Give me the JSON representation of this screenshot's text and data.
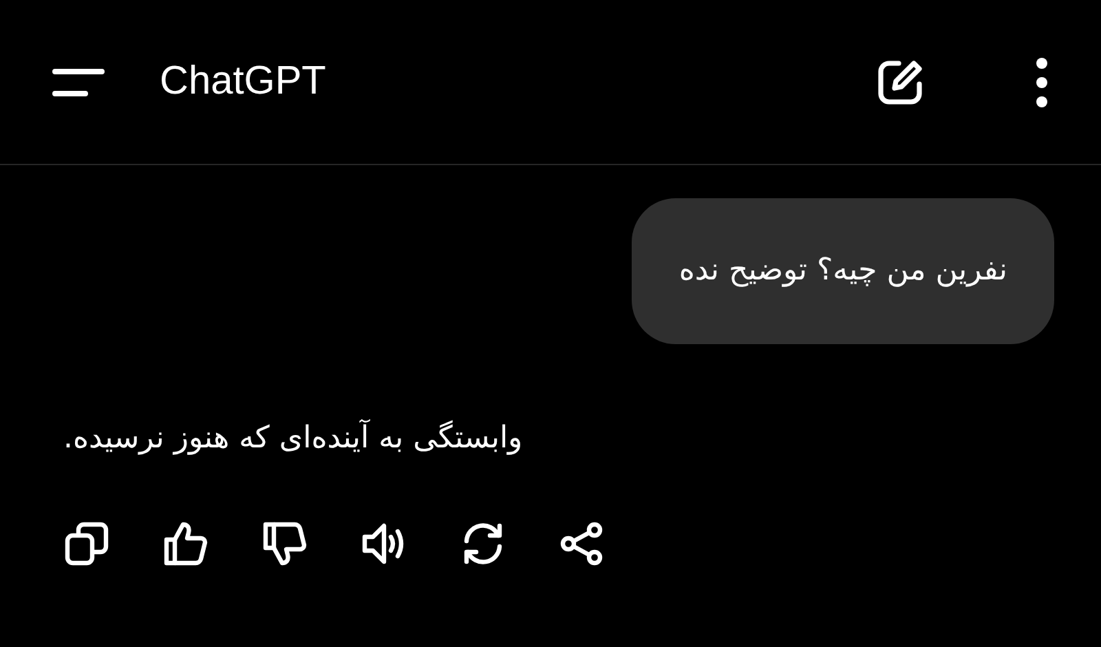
{
  "header": {
    "title": "ChatGPT"
  },
  "messages": [
    {
      "kind": "user",
      "text": "نفرین من چیه؟ توضیح نده"
    },
    {
      "kind": "assistant",
      "text": "وابستگی به آینده‌ای که هنوز نرسیده."
    }
  ]
}
